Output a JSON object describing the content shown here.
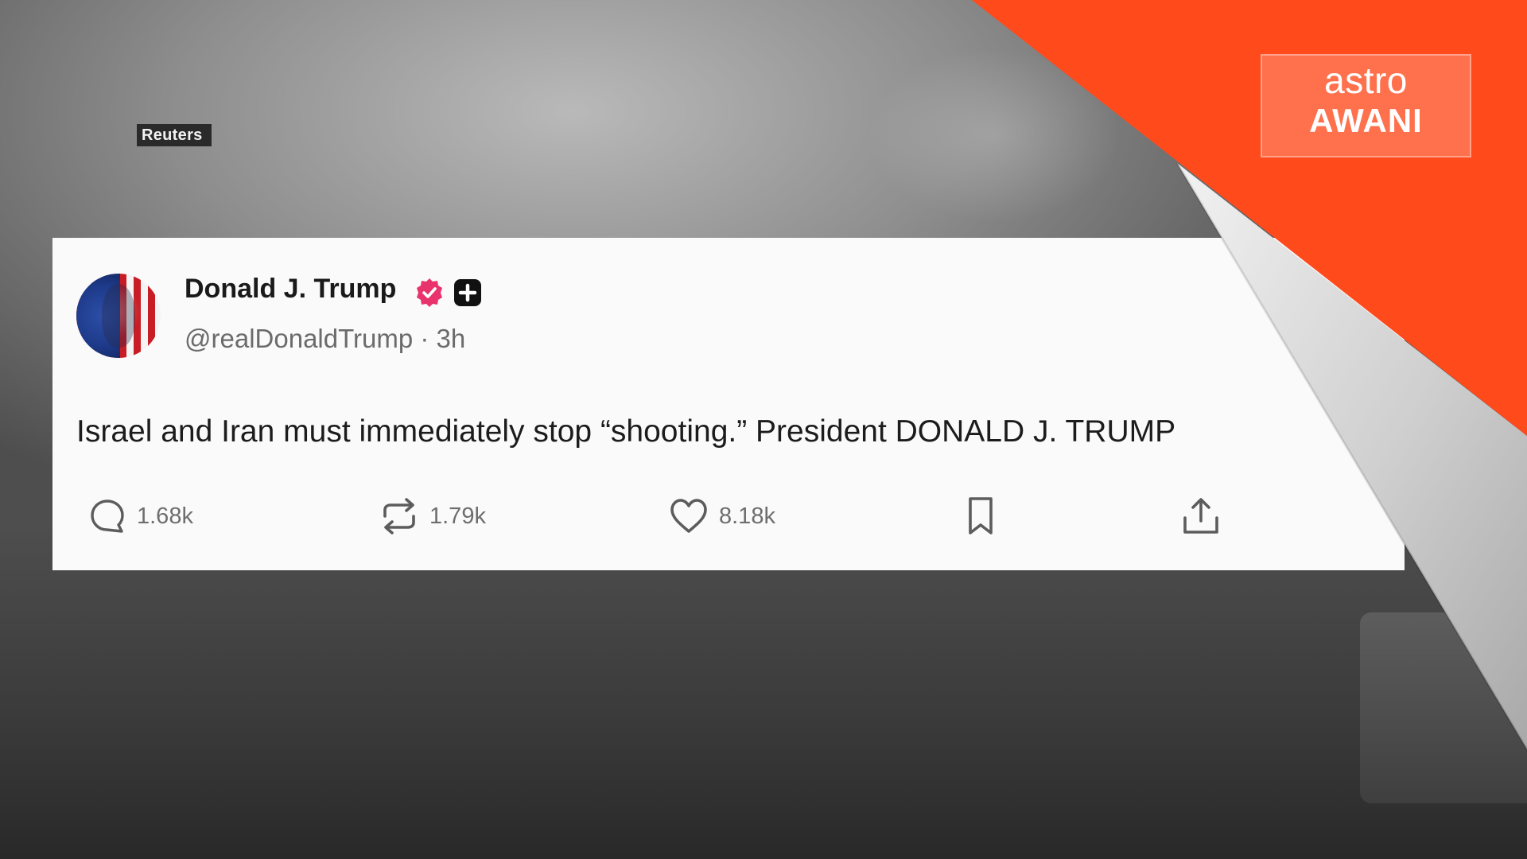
{
  "credit": "Reuters",
  "brand": {
    "top": "astro",
    "bottom": "AWANI",
    "color": "#ff4a1c"
  },
  "post": {
    "author": "Donald J. Trump",
    "handle_line": "@realDonaldTrump · 3h",
    "text": "Israel and Iran must immediately stop “shooting.” President DONALD J. TRUMP",
    "actions": {
      "replies": "1.68k",
      "reposts": "1.79k",
      "likes": "8.18k"
    },
    "icons": [
      "reply-icon",
      "repost-icon",
      "like-icon",
      "bookmark-icon",
      "share-icon"
    ],
    "verified_color": "#e8336d"
  }
}
